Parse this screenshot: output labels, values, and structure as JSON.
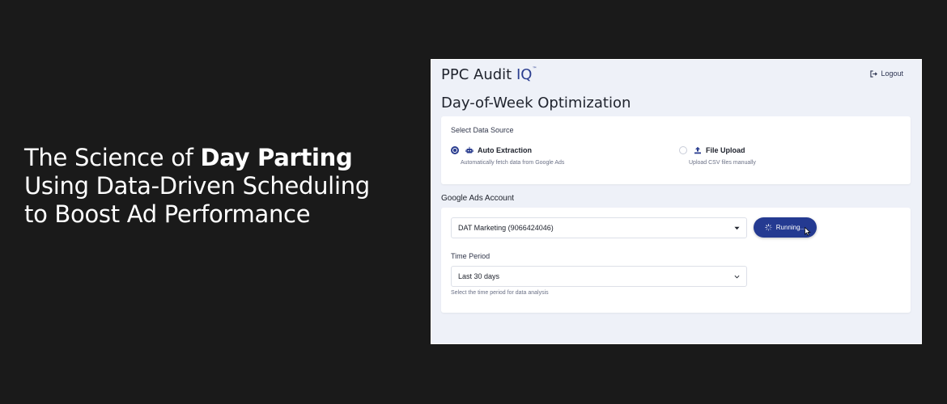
{
  "headline": {
    "line1_prefix": "The Science of ",
    "line1_bold": "Day Parting",
    "line2": "Using Data-Driven Scheduling",
    "line3": "to Boost Ad Performance"
  },
  "app": {
    "brand_main": "PPC Audit ",
    "brand_accent": "IQ",
    "brand_mark": "™",
    "logout_label": "Logout",
    "page_title": "Day-of-Week Optimization",
    "data_source": {
      "label": "Select Data Source",
      "options": [
        {
          "title": "Auto Extraction",
          "desc": "Automatically fetch data from Google Ads",
          "selected": true,
          "icon": "robot-icon"
        },
        {
          "title": "File Upload",
          "desc": "Upload CSV files manually",
          "selected": false,
          "icon": "upload-icon"
        }
      ]
    },
    "account": {
      "section_label": "Google Ads Account",
      "selected_account": "DAT Marketing (9066424046)",
      "run_button_label": "Running...",
      "time_period_label": "Time Period",
      "time_period_value": "Last 30 days",
      "time_period_help": "Select the time period for data analysis"
    }
  },
  "colors": {
    "page_bg": "#1a1a1a",
    "app_bg": "#eef1f8",
    "accent": "#243a91",
    "text": "#20242e"
  }
}
